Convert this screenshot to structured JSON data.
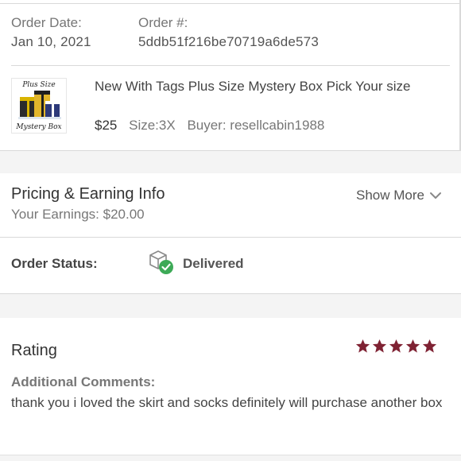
{
  "order": {
    "date_label": "Order Date:",
    "date_value": "Jan 10, 2021",
    "number_label": "Order #:",
    "number_value": "5ddb51f216be70719a6de573"
  },
  "product": {
    "thumb_top_text": "Plus Size",
    "thumb_bottom_text": "Mystery Box",
    "title": "New With Tags Plus Size Mystery Box Pick Your size",
    "price": "$25",
    "size": "Size:3X",
    "buyer": "Buyer: resellcabin1988"
  },
  "pricing": {
    "title": "Pricing & Earning Info",
    "earnings": "Your Earnings: $20.00",
    "show_more": "Show More",
    "icon": "chevron-down-icon"
  },
  "status": {
    "label": "Order Status:",
    "value": "Delivered",
    "icon": "delivered-package-icon",
    "accent_color": "#3daa57"
  },
  "rating": {
    "title": "Rating",
    "stars": 5,
    "star_color": "#7f2233",
    "comments_label": "Additional Comments:",
    "comment": "thank you i loved the skirt and socks definitely will purchase another box"
  }
}
